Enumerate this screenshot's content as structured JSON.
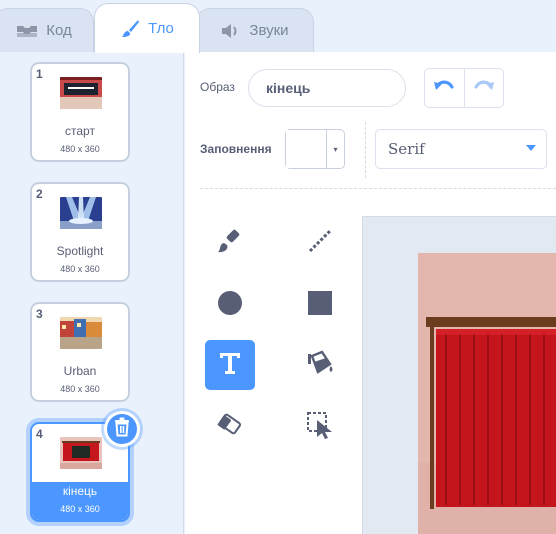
{
  "tabs": {
    "code": {
      "label": "Код",
      "icon": "code-icon"
    },
    "backdrop": {
      "label": "Тло",
      "icon": "brush-icon"
    },
    "sounds": {
      "label": "Звуки",
      "icon": "speaker-icon"
    }
  },
  "backdrops": [
    {
      "number": "1",
      "name": "старт",
      "size": "480 x 360"
    },
    {
      "number": "2",
      "name": "Spotlight",
      "size": "480 x 360"
    },
    {
      "number": "3",
      "name": "Urban",
      "size": "480 x 360"
    },
    {
      "number": "4",
      "name": "кінець",
      "size": "480 x 360",
      "selected": true
    }
  ],
  "editor": {
    "costume_label": "Образ",
    "costume_name": "кінець",
    "fill_label": "Заповнення",
    "fill_color": "#ffffff",
    "font": "Serif",
    "active_tool": "text"
  },
  "colors": {
    "accent": "#4c97ff",
    "text": "#575e75",
    "tool_icon": "#575e75"
  }
}
